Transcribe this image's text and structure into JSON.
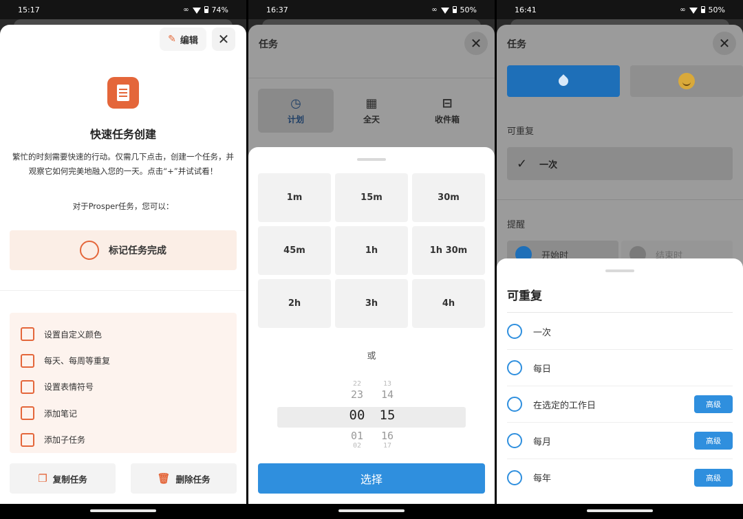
{
  "phone1": {
    "status": {
      "time": "15:17",
      "battery": "74%"
    },
    "edit_label": "编辑",
    "title": "快速任务创建",
    "description": "繁忙的时刻需要快速的行动。仅需几下点击，创建一个任务，并观察它如何完美地融入您的一天。点击“+”并试试看！",
    "subtitle": "对于Prosper任务，您可以：",
    "complete_label": "标记任务完成",
    "features": [
      "设置自定义颜色",
      "每天、每周等重复",
      "设置表情符号",
      "添加笔记",
      "添加子任务"
    ],
    "copy_label": "复制任务",
    "delete_label": "删除任务"
  },
  "phone2": {
    "status": {
      "time": "16:37",
      "battery": "50%"
    },
    "header_title": "任务",
    "segments": [
      "计划",
      "全天",
      "收件箱"
    ],
    "durations": [
      "1m",
      "15m",
      "30m",
      "45m",
      "1h",
      "1h 30m",
      "2h",
      "3h",
      "4h"
    ],
    "or_label": "或",
    "picker": {
      "hours": [
        "22",
        "23",
        "00",
        "01",
        "02"
      ],
      "minutes": [
        "13",
        "14",
        "15",
        "16",
        "17"
      ]
    },
    "select_label": "选择"
  },
  "phone3": {
    "status": {
      "time": "16:41",
      "battery": "50%"
    },
    "header_title": "任务",
    "repeat_label": "可重复",
    "repeat_value": "一次",
    "reminder_label": "提醒",
    "reminder_start": "开始时",
    "reminder_end": "结束时",
    "sheet_title": "可重复",
    "options": [
      {
        "label": "一次",
        "badge": ""
      },
      {
        "label": "每日",
        "badge": ""
      },
      {
        "label": "在选定的工作日",
        "badge": "高级"
      },
      {
        "label": "每月",
        "badge": "高级"
      },
      {
        "label": "每年",
        "badge": "高级"
      }
    ]
  },
  "colors": {
    "accent_orange": "#e4663a",
    "accent_blue": "#2f8fde"
  }
}
